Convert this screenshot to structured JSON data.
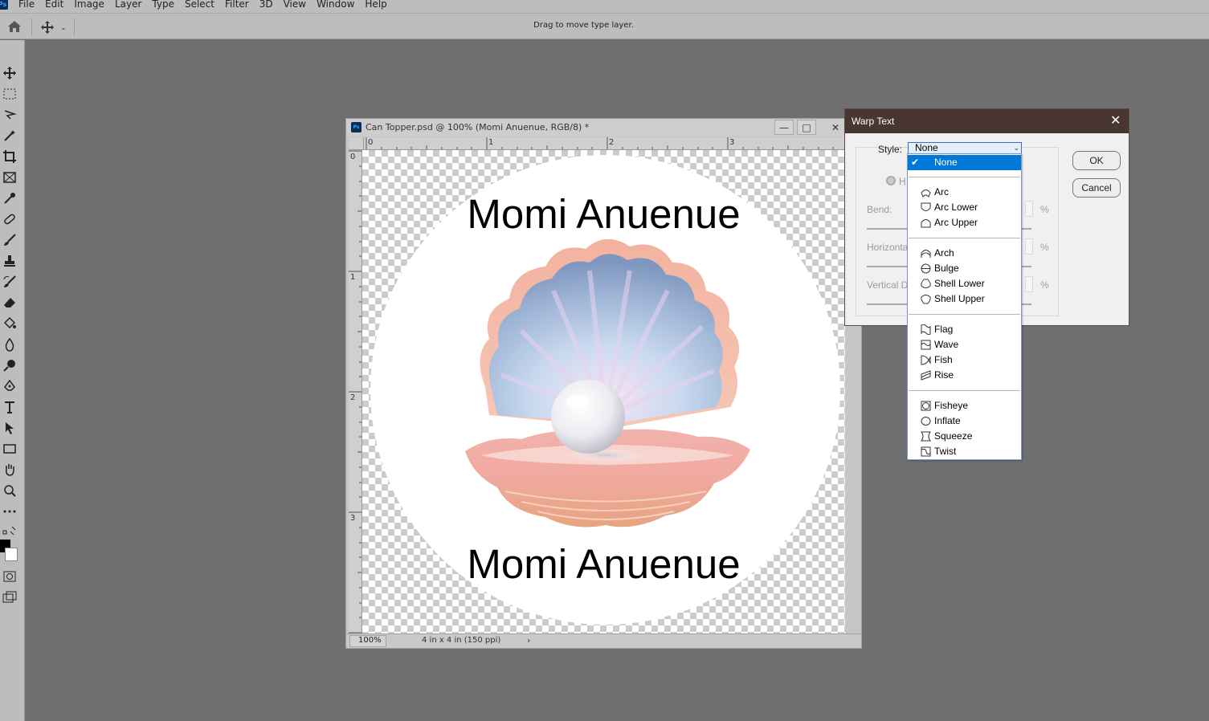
{
  "menubar": {
    "items": [
      "File",
      "Edit",
      "Image",
      "Layer",
      "Type",
      "Select",
      "Filter",
      "3D",
      "View",
      "Window",
      "Help"
    ]
  },
  "options_bar": {
    "hint": "Drag to move type layer."
  },
  "document": {
    "title": "Can Topper.psd @ 100% (Momi Anuenue, RGB/8) *",
    "ruler_h": [
      "0",
      "1",
      "2",
      "3"
    ],
    "ruler_v": [
      "0",
      "1",
      "2",
      "3"
    ],
    "text_top": "Momi Anuenue",
    "text_bottom": "Momi Anuenue",
    "zoom": "100%",
    "doc_info": "4 in x 4 in (150 ppi)"
  },
  "warp_dialog": {
    "title": "Warp Text",
    "style_label": "Style:",
    "style_value": "None",
    "radio_label": "H",
    "bend_label": "Bend:",
    "horizontal_label": "Horizonta",
    "vertical_label": "Vertical D",
    "percent": "%",
    "ok_label": "OK",
    "cancel_label": "Cancel"
  },
  "style_options": [
    {
      "label": "None",
      "icon": "none",
      "selected": true
    },
    {
      "label": "Arc",
      "icon": "arc-icon"
    },
    {
      "label": "Arc Lower",
      "icon": "arc-lower-icon"
    },
    {
      "label": "Arc Upper",
      "icon": "arc-upper-icon"
    },
    {
      "label": "Arch",
      "icon": "arch-icon"
    },
    {
      "label": "Bulge",
      "icon": "bulge-icon"
    },
    {
      "label": "Shell Lower",
      "icon": "shell-lower-icon"
    },
    {
      "label": "Shell Upper",
      "icon": "shell-upper-icon"
    },
    {
      "label": "Flag",
      "icon": "flag-icon"
    },
    {
      "label": "Wave",
      "icon": "wave-icon"
    },
    {
      "label": "Fish",
      "icon": "fish-icon"
    },
    {
      "label": "Rise",
      "icon": "rise-icon"
    },
    {
      "label": "Fisheye",
      "icon": "fisheye-icon"
    },
    {
      "label": "Inflate",
      "icon": "inflate-icon"
    },
    {
      "label": "Squeeze",
      "icon": "squeeze-icon"
    },
    {
      "label": "Twist",
      "icon": "twist-icon"
    }
  ],
  "colors": {
    "accent": "#0078d7",
    "dialog_title": "#4a3631",
    "workspace": "#6f6f6f"
  }
}
